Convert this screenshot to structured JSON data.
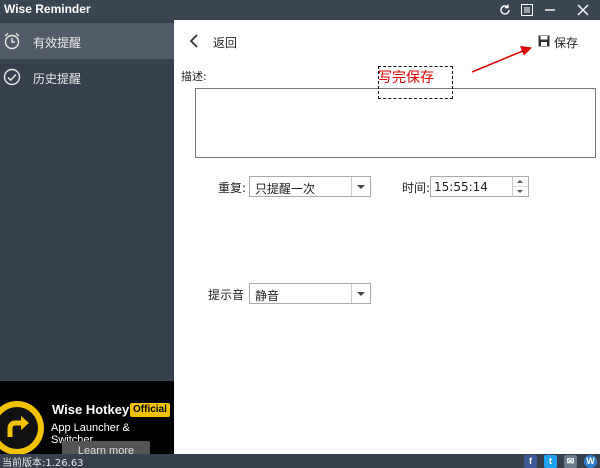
{
  "window": {
    "title": "Wise Reminder"
  },
  "sidebar": {
    "items": [
      {
        "label": "有效提醒",
        "icon": "alarm-clock-icon",
        "active": true
      },
      {
        "label": "历史提醒",
        "icon": "check-circle-icon",
        "active": false
      }
    ]
  },
  "promo": {
    "title": "Wise Hotkey",
    "badge": "Official",
    "subtitle": "App Launcher & Switcher",
    "button": "Learn more"
  },
  "statusbar": {
    "version": "当前版本:1.26.63",
    "social": [
      "f",
      "t",
      "✉",
      "W"
    ]
  },
  "main": {
    "back_label": "返回",
    "save_label": "保存",
    "description_label": "描述:",
    "description_value": "",
    "annotation": "写完保存",
    "repeat_label": "重复:",
    "repeat_value": "只提醒一次",
    "time_label": "时间:",
    "time_value": "15:55:14",
    "sound_label": "提示音",
    "sound_value": "静音"
  },
  "colors": {
    "titlebar": "#3a4552",
    "sidebar": "#36414d",
    "sidebar_active": "#525c68",
    "promo_badge": "#f2c200",
    "annotation": "#e00000",
    "facebook": "#3b5998",
    "twitter": "#1da1f2",
    "mail": "#6b7b8c",
    "wise": "#2f7fd0"
  }
}
